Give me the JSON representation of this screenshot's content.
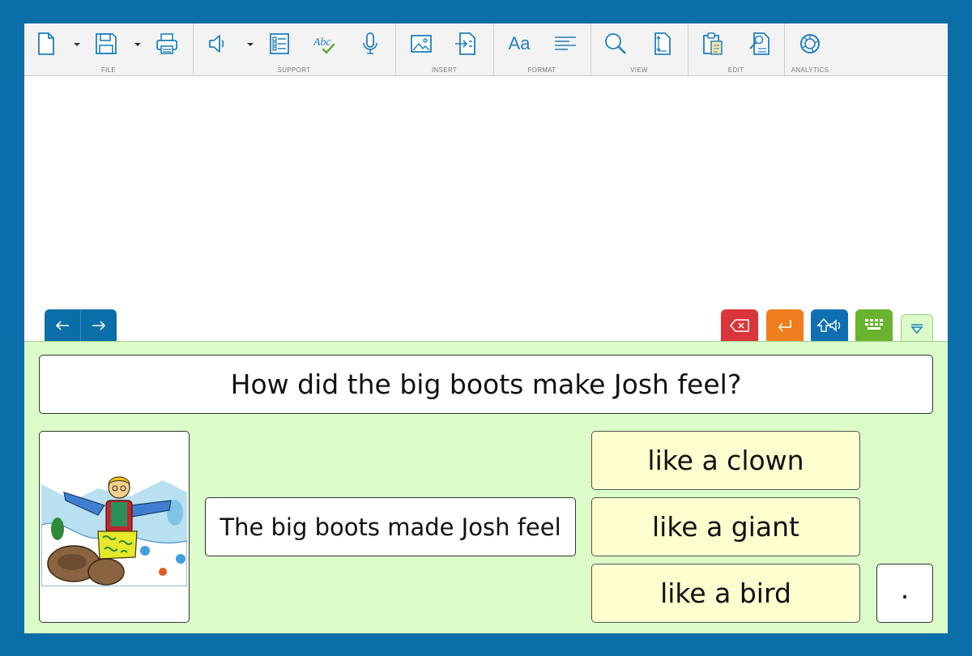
{
  "ribbon": {
    "groups": [
      {
        "label": "FILE"
      },
      {
        "label": "SUPPORT"
      },
      {
        "label": "INSERT"
      },
      {
        "label": "FORMAT"
      },
      {
        "label": "VIEW"
      },
      {
        "label": "EDIT"
      },
      {
        "label": "ANALYTICS"
      }
    ],
    "format_font_icon_text": "Aa",
    "spellcheck_icon_text": "Abc"
  },
  "panel": {
    "question": "How did the big boots make Josh feel?",
    "sentence": "The big boots made Josh feel",
    "choices": [
      "like a clown",
      "like a giant",
      "like a bird"
    ],
    "punctuation": "."
  },
  "colors": {
    "frame": "#0c6ea8",
    "icon_blue": "#1f7fc0",
    "panel_green": "#dbfbc9",
    "choice_yellow": "#fefecf",
    "delete_red": "#d9353b",
    "enter_orange": "#f07d1e",
    "speak_blue": "#0f6fb2",
    "keyboard_green": "#6ab32e"
  },
  "icons": [
    "new-document-icon",
    "save-icon",
    "print-icon",
    "speaker-icon",
    "word-list-icon",
    "spellcheck-icon",
    "microphone-icon",
    "image-icon",
    "insert-file-icon",
    "font-icon",
    "align-icon",
    "zoom-icon",
    "page-size-icon",
    "paste-icon",
    "find-replace-icon",
    "analytics-icon",
    "arrow-left-icon",
    "arrow-right-icon",
    "backspace-icon",
    "enter-icon",
    "speak-icon",
    "keyboard-icon",
    "collapse-icon"
  ]
}
